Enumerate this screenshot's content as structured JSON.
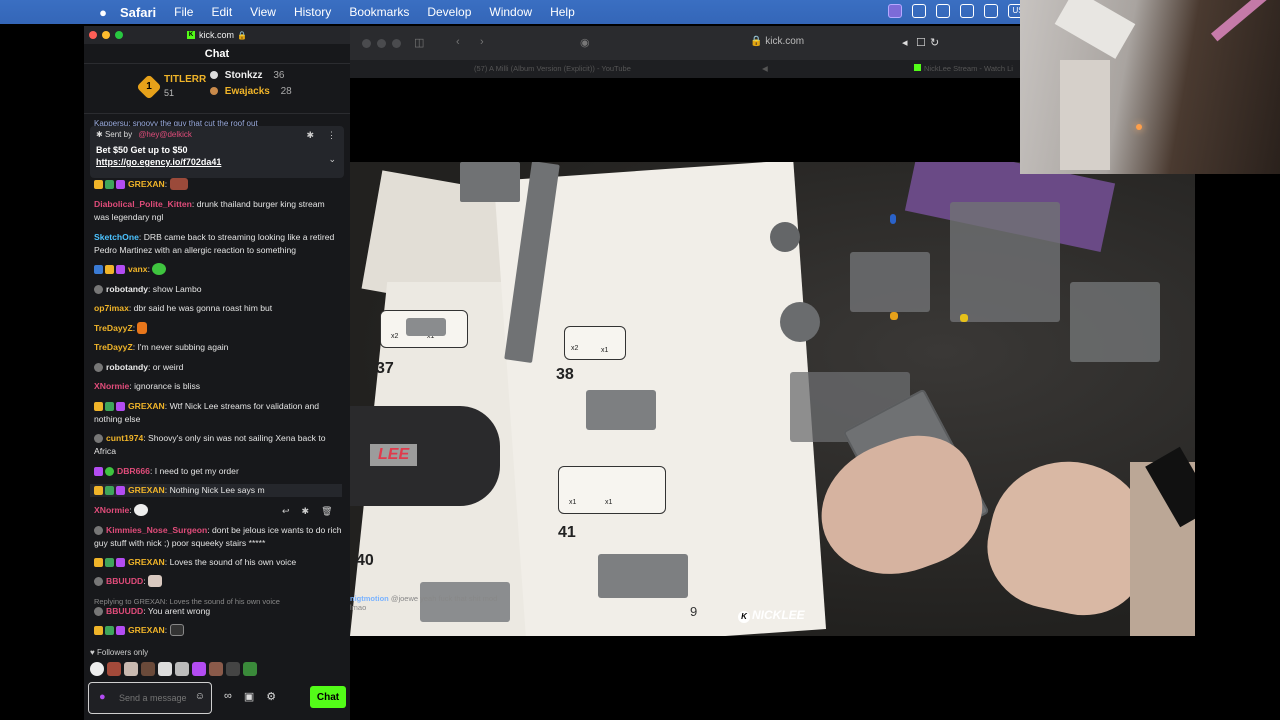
{
  "menubar": {
    "apple": "",
    "app": "Safari",
    "items": [
      "File",
      "Edit",
      "View",
      "History",
      "Bookmarks",
      "Develop",
      "Window",
      "Help"
    ],
    "input_source": "US"
  },
  "chat_window": {
    "url": "kick.com",
    "header": "Chat",
    "leaderboard": {
      "first": {
        "rank": "1",
        "name": "TITLERR",
        "count": "51"
      },
      "second": {
        "name": "Stonkzz",
        "count": "36"
      },
      "third": {
        "name": "Ewajacks",
        "count": "28"
      }
    },
    "partial_message": "Kappersu: snoovy the guy that cut the roof out",
    "pinned": {
      "label": "Sent by",
      "sender": "@hey@delkick",
      "text": "Bet $50 Get up to $50",
      "link": "https://go.egency.io/f702da41"
    },
    "messages": [
      {
        "user": "GREXAN",
        "color": "#f0b429",
        "text": ""
      },
      {
        "user": "Diabolical_Polite_Kitten",
        "color": "#e04c7a",
        "text": "drunk thailand burger king stream was legendary ngl"
      },
      {
        "user": "SketchOne",
        "color": "#4cc3ff",
        "text": "DRB came back to streaming looking like a retired Pedro Martinez with an allergic reaction to something"
      },
      {
        "user": "vanx",
        "color": "#f0b429",
        "text": ""
      },
      {
        "user": "robotandy",
        "color": "#eaeaea",
        "text": "show Lambo"
      },
      {
        "user": "op7imax",
        "color": "#f0b429",
        "text": "dbr said he was gonna roast him but"
      },
      {
        "user": "TreDayyZ",
        "color": "#f0b429",
        "text": ""
      },
      {
        "user": "TreDayyZ",
        "color": "#f0b429",
        "text": "I'm never subbing again"
      },
      {
        "user": "robotandy",
        "color": "#eaeaea",
        "text": "or weird"
      },
      {
        "user": "XNormie",
        "color": "#e04c7a",
        "text": "ignorance is bliss"
      },
      {
        "user": "GREXAN",
        "color": "#f0b429",
        "text": "Wtf Nick Lee streams for validation and nothing else"
      },
      {
        "user": "cunt1974",
        "color": "#f0b429",
        "text": "Shoovy's only sin was not sailing Xena back to Africa"
      },
      {
        "user": "DBR666",
        "color": "#e04c7a",
        "text": "I need to get my order"
      },
      {
        "user": "GREXAN",
        "color": "#f0b429",
        "text": "Nothing Nick Lee says m"
      },
      {
        "user": "XNormie",
        "color": "#e04c7a",
        "text": ""
      },
      {
        "user": "Kimmies_Nose_Surgeon",
        "color": "#e04c7a",
        "text": "dont be jelous ice wants to do rich guy stuff with nick ;) poor squeeky stairs *****"
      },
      {
        "user": "GREXAN",
        "color": "#f0b429",
        "text": "Loves the sound of his own voice"
      },
      {
        "user": "BBUUDD",
        "color": "#e04c7a",
        "text": ""
      },
      {
        "user": "BBUUDD",
        "color": "#e04c7a",
        "text": "You arent wrong"
      },
      {
        "user": "GREXAN",
        "color": "#f0b429",
        "text": ""
      }
    ],
    "reply_context": "Replying to GREXAN: Loves the sound of his own voice",
    "followers_only": "Followers only",
    "input_placeholder": "Send a message",
    "send_label": "Chat"
  },
  "safari": {
    "url": "kick.com",
    "tabs": [
      "(57) A Milli (Album Version (Explicit)) - YouTube",
      "NickLee Stream - Watch Li"
    ]
  },
  "video": {
    "watermark": "NICKLEE",
    "steps": [
      "37",
      "38",
      "41",
      "40",
      "9"
    ],
    "overlay_user": "nigtmotion",
    "overlay_text": "@joewe yeah fuck that shit mod",
    "overlay_extra": "lmao",
    "box_label": "LEE",
    "parts_x2": "x2",
    "parts_x1": "x1"
  },
  "colors": {
    "kick_green": "#53fc18",
    "chat_bg": "#17181b",
    "accent_gold": "#f0b429"
  }
}
